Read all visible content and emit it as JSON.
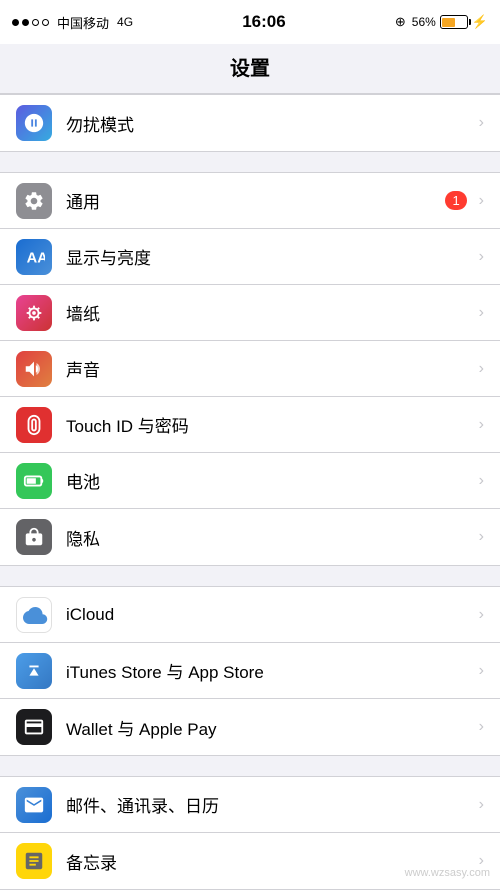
{
  "statusBar": {
    "carrier": "中国移动",
    "network": "4G",
    "time": "16:06",
    "batteryPercent": "56%",
    "signalFull": 2,
    "signalEmpty": 2
  },
  "header": {
    "title": "设置"
  },
  "sections": [
    {
      "id": "section-dnd",
      "rows": [
        {
          "id": "dnd",
          "iconType": "purple-blue",
          "iconName": "dnd-icon",
          "label": "勿扰模式",
          "badge": null
        }
      ]
    },
    {
      "id": "section-display",
      "rows": [
        {
          "id": "general",
          "iconType": "gray",
          "iconName": "general-icon",
          "label": "通用",
          "badge": "1"
        },
        {
          "id": "display",
          "iconType": "blue",
          "iconName": "display-icon",
          "label": "显示与亮度",
          "badge": null
        },
        {
          "id": "wallpaper",
          "iconType": "pink",
          "iconName": "wallpaper-icon",
          "label": "墙纸",
          "badge": null
        },
        {
          "id": "sounds",
          "iconType": "red-orange",
          "iconName": "sounds-icon",
          "label": "声音",
          "badge": null
        },
        {
          "id": "touchid",
          "iconType": "red",
          "iconName": "touchid-icon",
          "label": "Touch ID 与密码",
          "badge": null
        },
        {
          "id": "battery",
          "iconType": "green",
          "iconName": "battery-icon",
          "label": "电池",
          "badge": null
        },
        {
          "id": "privacy",
          "iconType": "dark-gray",
          "iconName": "privacy-icon",
          "label": "隐私",
          "badge": null
        }
      ]
    },
    {
      "id": "section-accounts",
      "rows": [
        {
          "id": "icloud",
          "iconType": "icloud-blue",
          "iconName": "icloud-icon",
          "label": "iCloud",
          "badge": null
        },
        {
          "id": "itunes",
          "iconType": "itunes",
          "iconName": "itunes-icon",
          "label": "iTunes Store 与 App Store",
          "badge": null
        },
        {
          "id": "wallet",
          "iconType": "wallet",
          "iconName": "wallet-icon",
          "label": "Wallet 与 Apple Pay",
          "badge": null
        }
      ]
    },
    {
      "id": "section-apps",
      "rows": [
        {
          "id": "mail",
          "iconType": "mail-blue",
          "iconName": "mail-icon",
          "label": "邮件、通讯录、日历",
          "badge": null
        },
        {
          "id": "notes",
          "iconType": "yellow",
          "iconName": "notes-icon",
          "label": "备忘录",
          "badge": null
        }
      ]
    }
  ],
  "chevron": "›",
  "watermark": "www.wzsasy.com"
}
